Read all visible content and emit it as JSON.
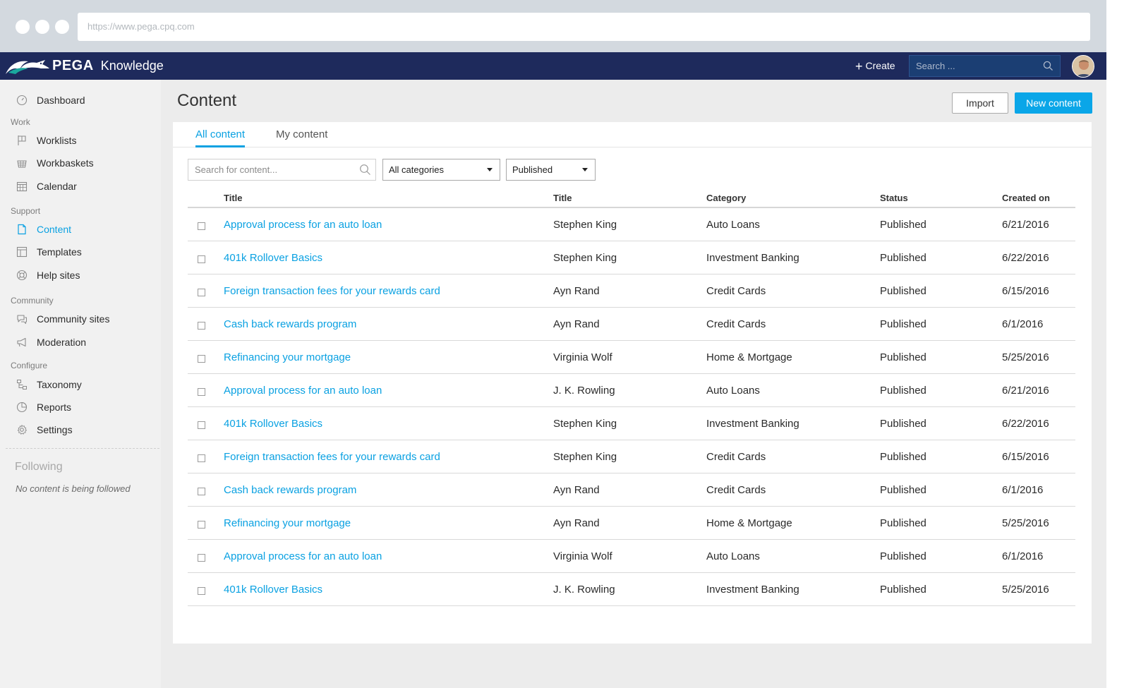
{
  "browser": {
    "url": "https://www.pega.cpq.com"
  },
  "header": {
    "brand": "PEGA",
    "product": "Knowledge",
    "create_label": "Create",
    "search_placeholder": "Search ..."
  },
  "sidebar": {
    "dashboard": "Dashboard",
    "sections": {
      "work": "Work",
      "support": "Support",
      "community": "Community",
      "configure": "Configure"
    },
    "items": {
      "worklists": "Worklists",
      "workbaskets": "Workbaskets",
      "calendar": "Calendar",
      "content": "Content",
      "templates": "Templates",
      "help_sites": "Help sites",
      "community_sites": "Community sites",
      "moderation": "Moderation",
      "taxonomy": "Taxonomy",
      "reports": "Reports",
      "settings": "Settings"
    },
    "following_title": "Following",
    "following_empty": "No content is being followed",
    "active_color": "#0aa1e2"
  },
  "main": {
    "title": "Content",
    "import_label": "Import",
    "new_content_label": "New content",
    "tabs": [
      {
        "label": "All content",
        "active": true
      },
      {
        "label": "My content",
        "active": false
      }
    ],
    "filters": {
      "search_placeholder": "Search for content...",
      "category": "All categories",
      "status": "Published"
    },
    "columns": [
      "Title",
      "Title",
      "Category",
      "Status",
      "Created on"
    ],
    "rows": [
      {
        "title": "Approval process for an auto loan",
        "author": "Stephen King",
        "category": "Auto Loans",
        "status": "Published",
        "created": "6/21/2016"
      },
      {
        "title": "401k Rollover Basics",
        "author": "Stephen King",
        "category": "Investment Banking",
        "status": "Published",
        "created": "6/22/2016"
      },
      {
        "title": "Foreign transaction fees for your rewards card",
        "author": "Ayn Rand",
        "category": "Credit Cards",
        "status": "Published",
        "created": "6/15/2016"
      },
      {
        "title": "Cash back rewards program",
        "author": "Ayn Rand",
        "category": "Credit Cards",
        "status": "Published",
        "created": "6/1/2016"
      },
      {
        "title": "Refinancing your mortgage",
        "author": "Virginia Wolf",
        "category": "Home & Mortgage",
        "status": "Published",
        "created": "5/25/2016"
      },
      {
        "title": "Approval process for an auto loan",
        "author": "J. K. Rowling",
        "category": "Auto Loans",
        "status": "Published",
        "created": "6/21/2016"
      },
      {
        "title": "401k Rollover Basics",
        "author": "Stephen King",
        "category": "Investment Banking",
        "status": "Published",
        "created": "6/22/2016"
      },
      {
        "title": "Foreign transaction fees for your rewards card",
        "author": "Stephen King",
        "category": "Credit Cards",
        "status": "Published",
        "created": "6/15/2016"
      },
      {
        "title": "Cash back rewards program",
        "author": "Ayn Rand",
        "category": "Credit Cards",
        "status": "Published",
        "created": "6/1/2016"
      },
      {
        "title": "Refinancing your mortgage",
        "author": "Ayn Rand",
        "category": "Home & Mortgage",
        "status": "Published",
        "created": "5/25/2016"
      },
      {
        "title": "Approval process for an auto loan",
        "author": "Virginia Wolf",
        "category": "Auto Loans",
        "status": "Published",
        "created": "6/1/2016"
      },
      {
        "title": "401k Rollover Basics",
        "author": "J. K. Rowling",
        "category": "Investment Banking",
        "status": "Published",
        "created": "5/25/2016"
      }
    ]
  }
}
